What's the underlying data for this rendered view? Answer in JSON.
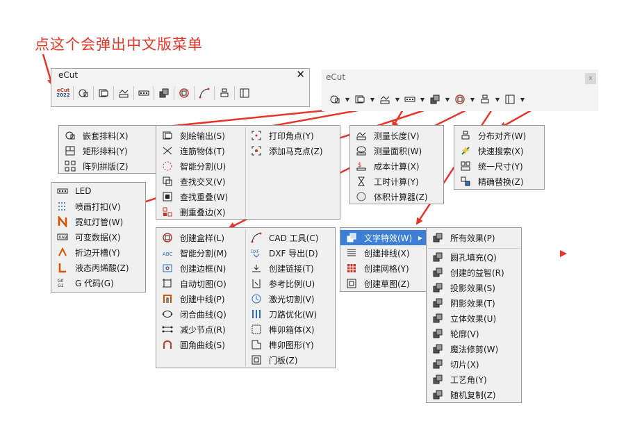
{
  "annotation": "点这个会弹出中文版菜单",
  "small_toolbar": {
    "title": "eCut",
    "close": "✕",
    "logo_line1": "eCut",
    "logo_line2": "2022"
  },
  "big_toolbar": {
    "title": "eCut",
    "close": "x"
  },
  "menus": {
    "nesting": [
      "嵌套排料(X)",
      "矩形排料(Y)",
      "阵列拼版(Z)"
    ],
    "output_left": [
      "刻绘输出(S)",
      "连筋物体(T)",
      "智能分割(U)",
      "查找交叉(V)",
      "查找重叠(W)",
      "删重叠边(X)"
    ],
    "output_right": [
      "打印角点(Y)",
      "添加马克点(Z)"
    ],
    "measure": [
      "测量长度(V)",
      "测量面积(W)",
      "成本计算(X)",
      "工时计算(Y)",
      "体积计算器(Z)"
    ],
    "align": [
      "分布对齐(W)",
      "快速搜索(X)",
      "统一尺寸(Y)",
      "精确替换(Z)"
    ],
    "led": [
      "LED",
      "喷画打扣(V)",
      "霓虹灯管(W)",
      "可变数据(X)",
      "折边开槽(Y)",
      "液态丙烯酸(Z)",
      "G 代码(G)"
    ],
    "create_left": [
      "创建盒样(L)",
      "智能分割(M)",
      "创建边框(N)",
      "自动切图(O)",
      "创建中线(P)",
      "闭合曲线(Q)",
      "减少节点(R)",
      "圆角曲线(S)"
    ],
    "create_right": [
      "CAD 工具(C)",
      "DXF 导出(D)",
      "创建链接(T)",
      "参考比例(U)",
      "激光切割(V)",
      "刀路优化(W)",
      "榫卯箱体(X)",
      "榫卯图形(Y)",
      "门板(Z)"
    ],
    "text": [
      "文字特效(W)",
      "创建排线(X)",
      "创建网格(Y)",
      "创建草图(Z)"
    ],
    "effects_top": "所有效果(P)",
    "effects": [
      "圆孔填充(Q)",
      "创建的益智(R)",
      "投影效果(S)",
      "阴影效果(T)",
      "立体效果(U)",
      "轮廓(V)",
      "魔法修剪(W)",
      "切片(X)",
      "工艺角(Y)",
      "随机复制(Z)"
    ]
  },
  "colors": {
    "accent": "#3e7fd6",
    "annotation": "#e8352a",
    "arrow": "#e8352a"
  }
}
